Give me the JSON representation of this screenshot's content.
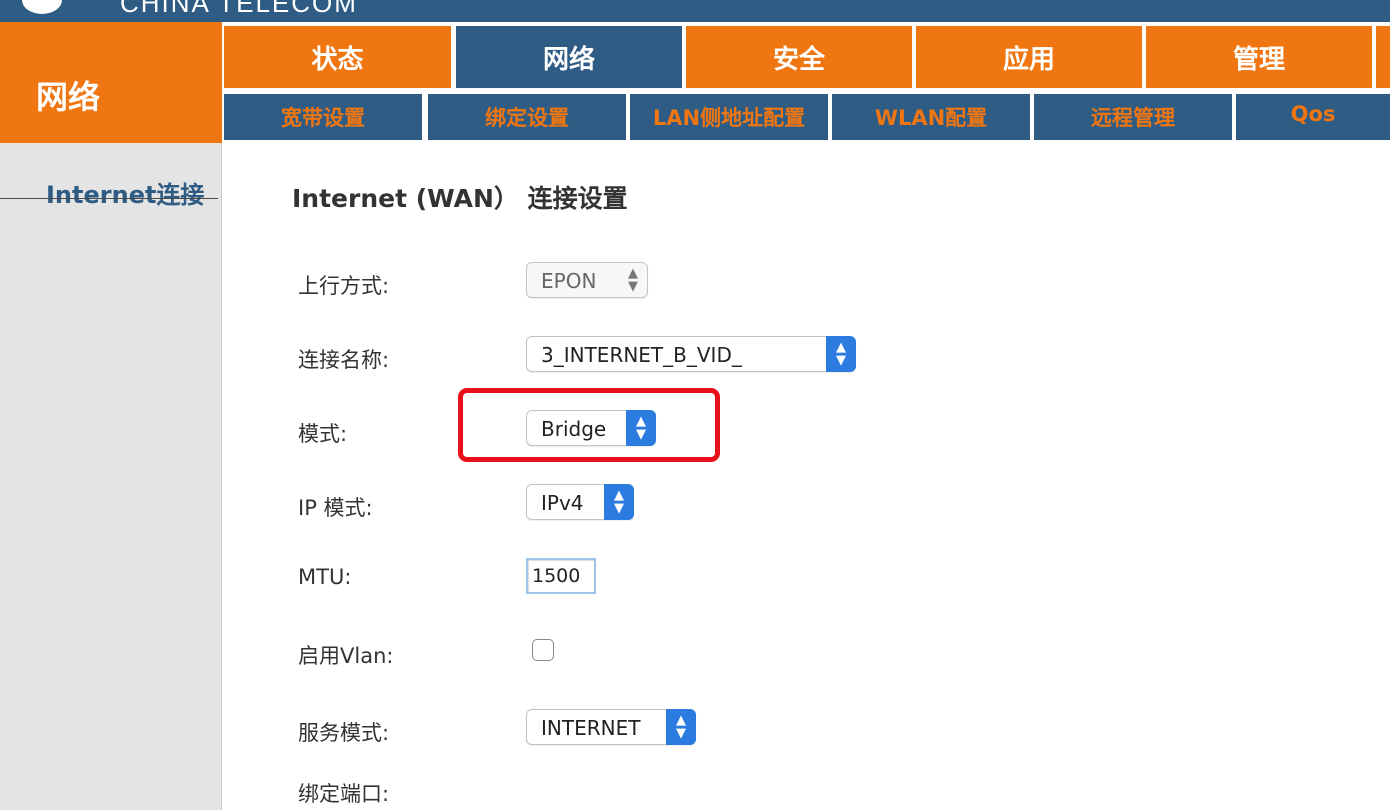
{
  "header": {
    "brand_text": "CHINA TELECOM",
    "section_title": "网络"
  },
  "main_nav": [
    {
      "label": "状态",
      "active": false
    },
    {
      "label": "网络",
      "active": true
    },
    {
      "label": "安全",
      "active": false
    },
    {
      "label": "应用",
      "active": false
    },
    {
      "label": "管理",
      "active": false
    }
  ],
  "sub_nav": [
    {
      "label": "宽带设置"
    },
    {
      "label": "绑定设置"
    },
    {
      "label": "LAN侧地址配置"
    },
    {
      "label": "WLAN配置"
    },
    {
      "label": "远程管理"
    },
    {
      "label": "Qos"
    }
  ],
  "sidebar": {
    "items": [
      {
        "label": "Internet连接"
      }
    ]
  },
  "form": {
    "heading": "Internet (WAN）  连接设置",
    "uplink_mode": {
      "label": "上行方式:",
      "value": "EPON"
    },
    "connection_name": {
      "label": "连接名称:",
      "value": "3_INTERNET_B_VID_"
    },
    "mode": {
      "label": "模式:",
      "value": "Bridge"
    },
    "ip_mode": {
      "label": "IP 模式:",
      "value": "IPv4"
    },
    "mtu": {
      "label": "MTU:",
      "value": "1500"
    },
    "enable_vlan": {
      "label": "启用Vlan:",
      "checked": false
    },
    "service_mode": {
      "label": "服务模式:",
      "value": "INTERNET"
    },
    "bind_port": {
      "label": "绑定端口:"
    }
  },
  "colors": {
    "orange": "#ef7611",
    "navy": "#2f5c85",
    "highlight_red": "#e8111b",
    "select_blue": "#2b7be0"
  }
}
